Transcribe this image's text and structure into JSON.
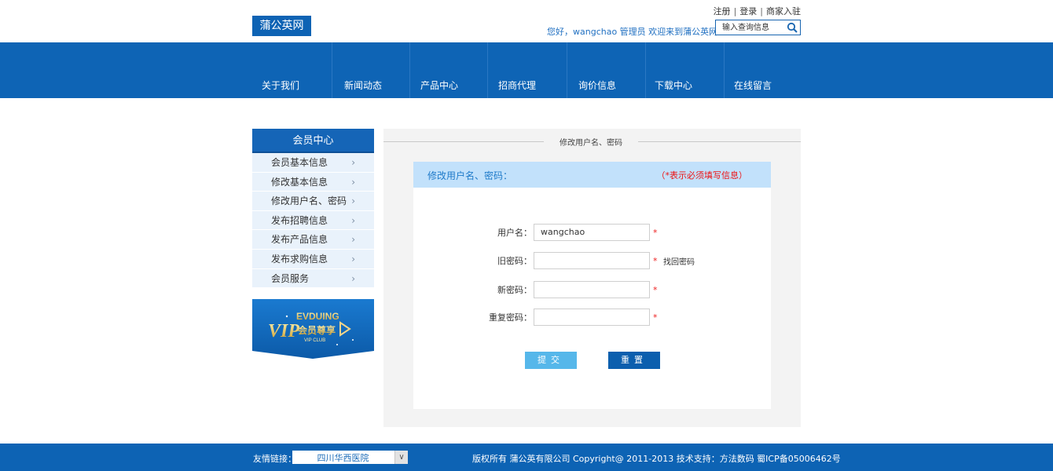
{
  "header": {
    "logo": "蒲公英网",
    "links": [
      "注册",
      "登录",
      "商家入驻"
    ],
    "welcome_prefix": "您好，",
    "welcome_user": "wangchao",
    "welcome_suffix": " 管理员 欢迎来到蒲公英网！",
    "search_placeholder": "输入查询信息"
  },
  "nav": [
    "关于我们",
    "新闻动态",
    "产品中心",
    "招商代理",
    "询价信息",
    "下载中心",
    "在线留言"
  ],
  "sidebar": {
    "title": "会员中心",
    "items": [
      "会员基本信息",
      "修改基本信息",
      "修改用户名、密码",
      "发布招聘信息",
      "发布产品信息",
      "发布求购信息",
      "会员服务"
    ],
    "vip_text": "会员尊享",
    "vip_small": "EVDUING",
    "vip_big": "VIP",
    "vip_club": "VIP CLUB"
  },
  "main": {
    "crumb": "修改用户名、密码",
    "panel_title": "修改用户名、密码：",
    "required_note": "（*表示必须填写信息）",
    "fields": [
      {
        "label": "用户名：",
        "value": "wangchao",
        "extra": ""
      },
      {
        "label": "旧密码：",
        "value": "",
        "extra": "找回密码"
      },
      {
        "label": "新密码：",
        "value": "",
        "extra": ""
      },
      {
        "label": "重复密码：",
        "value": "",
        "extra": ""
      }
    ],
    "star": "*",
    "submit": "提交",
    "reset": "重置"
  },
  "footer": {
    "links_label": "友情链接：",
    "select_value": "四川华西医院",
    "copyright": "版权所有   蒲公英有限公司 Copyright@ 2011-2013   技术支持：方法数码   蜀ICP备05006462号"
  },
  "colors": {
    "brand": "#0e64b5",
    "light_blue": "#c2e1fb",
    "required": "#e11111"
  }
}
